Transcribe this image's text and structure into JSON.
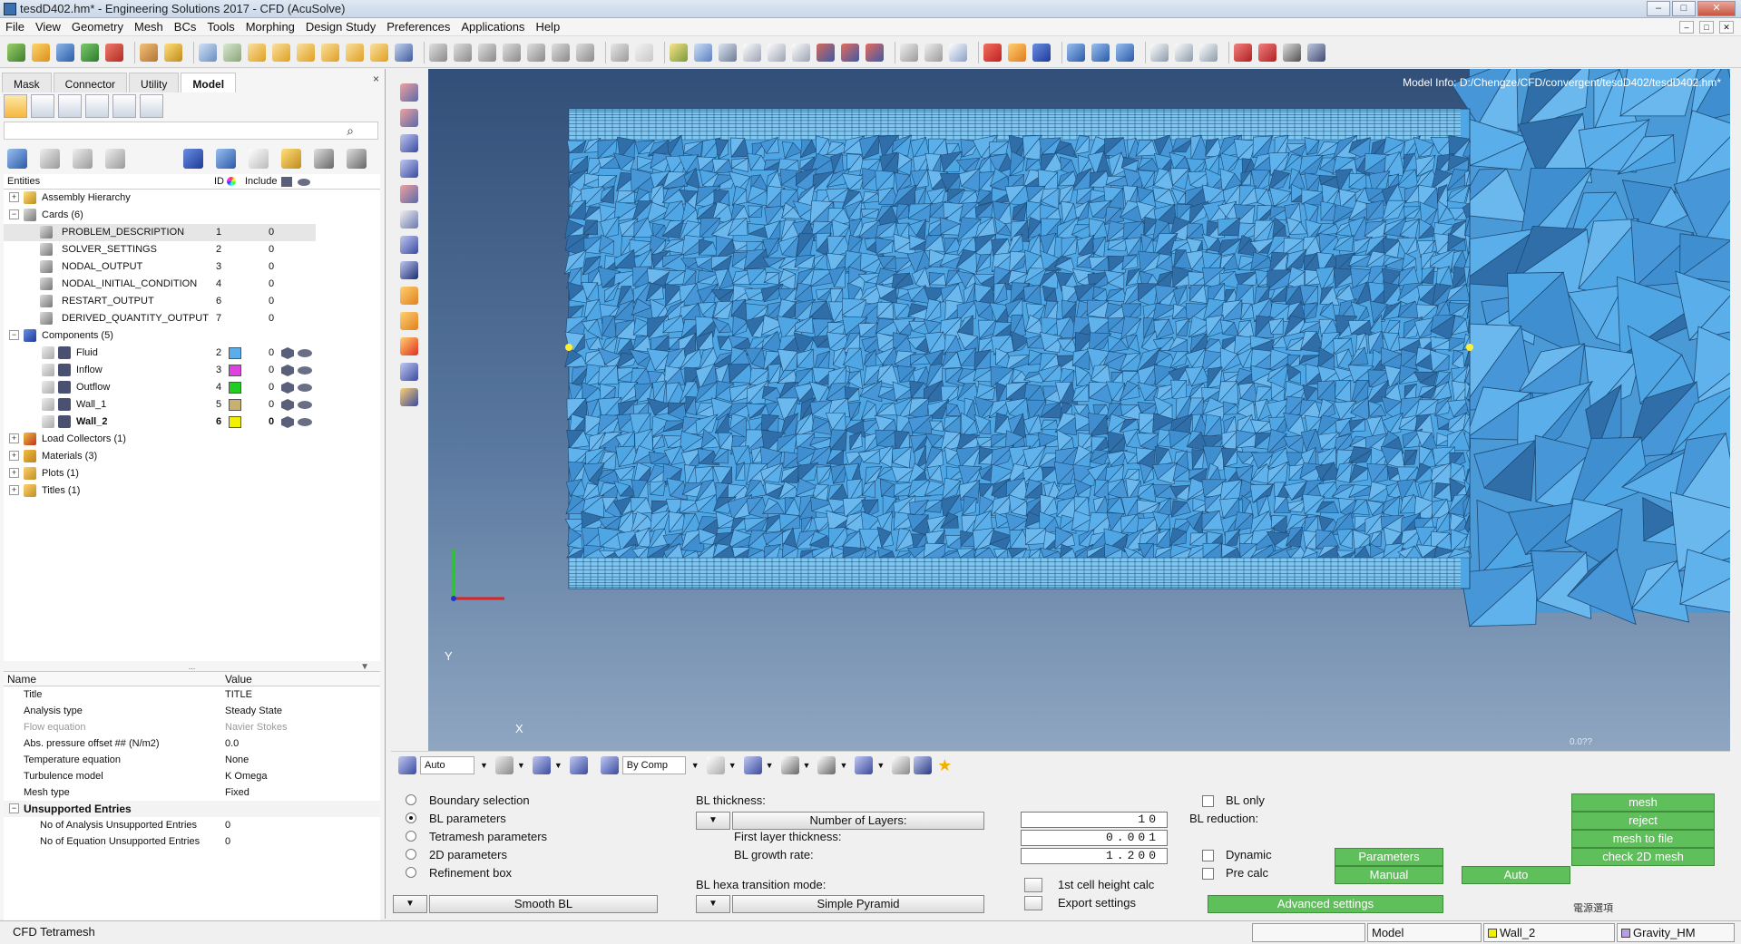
{
  "window": {
    "title": "tesdD402.hm* - Engineering Solutions 2017 - CFD (AcuSolve)",
    "controls": [
      "–",
      "□",
      "✕"
    ]
  },
  "menu": [
    "File",
    "View",
    "Geometry",
    "Mesh",
    "BCs",
    "Tools",
    "Morphing",
    "Design Study",
    "Preferences",
    "Applications",
    "Help"
  ],
  "menu_controls": [
    "–",
    "□",
    "✕"
  ],
  "panel": {
    "tabs": [
      "Mask",
      "Connector",
      "Utility",
      "Model"
    ],
    "active_tab": "Model",
    "close": "×",
    "search_icon": "⌕",
    "entities_header": {
      "entities": "Entities",
      "id": "ID",
      "include": "Include"
    },
    "tree": [
      {
        "label": "Assembly Hierarchy",
        "exp": "+"
      },
      {
        "label": "Cards (6)",
        "exp": "−"
      },
      {
        "label": "PROBLEM_DESCRIPTION",
        "id": "1",
        "include": "0"
      },
      {
        "label": "SOLVER_SETTINGS",
        "id": "2",
        "include": "0"
      },
      {
        "label": "NODAL_OUTPUT",
        "id": "3",
        "include": "0"
      },
      {
        "label": "NODAL_INITIAL_CONDITION",
        "id": "4",
        "include": "0"
      },
      {
        "label": "RESTART_OUTPUT",
        "id": "6",
        "include": "0"
      },
      {
        "label": "DERIVED_QUANTITY_OUTPUT",
        "id": "7",
        "include": "0"
      },
      {
        "label": "Components (5)",
        "exp": "−"
      },
      {
        "label": "Fluid",
        "id": "2",
        "include": "0",
        "color": "#5aaeea"
      },
      {
        "label": "Inflow",
        "id": "3",
        "include": "0",
        "color": "#e040e0"
      },
      {
        "label": "Outflow",
        "id": "4",
        "include": "0",
        "color": "#22cc22"
      },
      {
        "label": "Wall_1",
        "id": "5",
        "include": "0",
        "color": "#c8b070"
      },
      {
        "label": "Wall_2",
        "id": "6",
        "include": "0",
        "color": "#f0f000"
      },
      {
        "label": "Load Collectors (1)",
        "exp": "+"
      },
      {
        "label": "Materials (3)",
        "exp": "+"
      },
      {
        "label": "Plots (1)",
        "exp": "+"
      },
      {
        "label": "Titles (1)",
        "exp": "+"
      }
    ],
    "splitter_dots": "...",
    "splitter_arrow": "▼",
    "properties_header": {
      "name": "Name",
      "value": "Value"
    },
    "properties": [
      {
        "name": "Title",
        "value": "TITLE"
      },
      {
        "name": "Analysis type",
        "value": "Steady State"
      },
      {
        "name": "Flow equation",
        "value": "Navier Stokes",
        "dim": true
      },
      {
        "name": "Abs. pressure offset ## (N/m2)",
        "value": "0.0"
      },
      {
        "name": "Temperature equation",
        "value": "None"
      },
      {
        "name": "Turbulence model",
        "value": "K Omega"
      },
      {
        "name": "Mesh type",
        "value": "Fixed"
      }
    ],
    "unsupported": {
      "title": "Unsupported Entries",
      "exp": "−",
      "rows": [
        {
          "name": "No of Analysis Unsupported Entries",
          "value": "0"
        },
        {
          "name": "No of Equation Unsupported Entries",
          "value": "0"
        }
      ]
    }
  },
  "graphics": {
    "model_info": "Model Info: D:/Chengze/CFD/convergent/tesdD402/tesdD402.hm*",
    "axis_y": "Y",
    "axis_x": "X",
    "scale_label": "0.0??",
    "mesh_colors": {
      "fill": "#4fa6e4",
      "edge": "#1d4a73",
      "light": "#7fc6f0"
    }
  },
  "visbar": {
    "auto_select": "Auto",
    "bycomp_select": "By Comp",
    "dropdown_glyph": "▼",
    "star_icon": "★"
  },
  "bottom": {
    "radios": [
      {
        "label": "Boundary selection",
        "on": false
      },
      {
        "label": "BL parameters",
        "on": true
      },
      {
        "label": "Tetramesh parameters",
        "on": false
      },
      {
        "label": "2D parameters",
        "on": false
      },
      {
        "label": "Refinement box",
        "on": false
      }
    ],
    "smooth_bl": "Smooth BL",
    "bl_thickness_label": "BL thickness:",
    "number_of_layers_btn": "Number of Layers:",
    "number_of_layers_value": "10",
    "first_layer_label": "First layer thickness:",
    "first_layer_value": "0.001",
    "growth_rate_label": "BL growth rate:",
    "growth_rate_value": "1.200",
    "hexa_transition_label": "BL hexa transition mode:",
    "simple_pyramid": "Simple Pyramid",
    "first_cell_height": "1st cell height calc",
    "export_settings": "Export settings",
    "bl_only": "BL only",
    "bl_reduction": "BL reduction:",
    "dynamic": "Dynamic",
    "pre_calc": "Pre calc",
    "parameters_btn": "Parameters",
    "manual_btn": "Manual",
    "auto_btn": "Auto",
    "advanced_settings_btn": "Advanced settings",
    "mesh_btn": "mesh",
    "reject_btn": "reject",
    "mesh_to_file_btn": "mesh to file",
    "check_2d_btn": "check 2D mesh",
    "return_text": "電源選項",
    "dd": "▼"
  },
  "status": {
    "left": "CFD Tetramesh",
    "model": "Model",
    "component": "Wall_2",
    "component_color": "#f0f000",
    "loadcol": "Gravity_HM",
    "loadcol_color": "#b8a0e0"
  },
  "colors": {
    "accent_green": "#5fbf5a",
    "viewport_top": "#314f78",
    "viewport_bottom": "#8fa6c1"
  }
}
